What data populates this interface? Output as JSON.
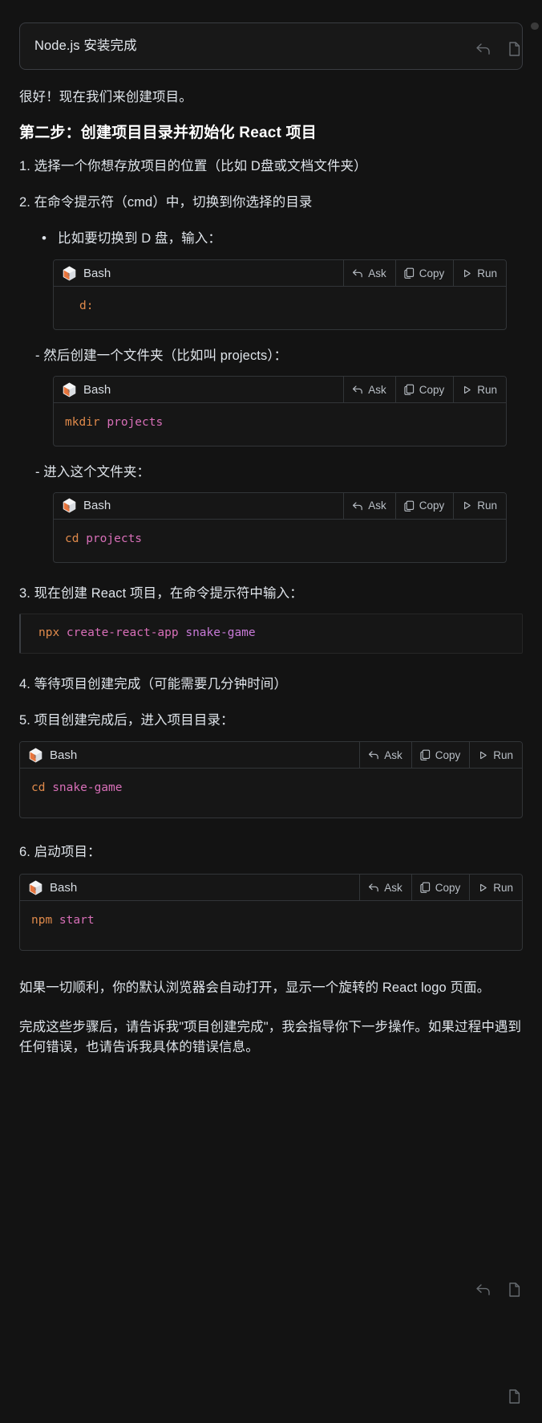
{
  "user_message": {
    "text": "Node.js 安装完成"
  },
  "assistant": {
    "intro": "很好！现在我们来创建项目。",
    "step_title": "第二步：创建项目目录并初始化 React 项目",
    "item1": "1. 选择一个你想存放项目的位置（比如 D盘或文档文件夹）",
    "item2": "2. 在命令提示符（cmd）中，切换到你选择的目录",
    "bullet1": "比如要切换到 D 盘，输入：",
    "dash1": "- 然后创建一个文件夹（比如叫 projects）：",
    "dash2": "- 进入这个文件夹：",
    "item3": "3. 现在创建 React 项目，在命令提示符中输入：",
    "item4": "4. 等待项目创建完成（可能需要几分钟时间）",
    "item5": "5. 项目创建完成后，进入项目目录：",
    "item6": "6. 启动项目：",
    "outro1": "如果一切顺利，你的默认浏览器会自动打开，显示一个旋转的 React logo 页面。",
    "outro2": "完成这些步骤后，请告诉我\"项目创建完成\"，我会指导你下一步操作。如果过程中遇到任何错误，也请告诉我具体的错误信息。"
  },
  "code_blocks": [
    {
      "id": "cd-d-drive",
      "language": "Bash",
      "code": "d:",
      "tokens": [
        {
          "text": "d:",
          "type": "cmd"
        }
      ],
      "actions": {
        "ask": "Ask",
        "copy": "Copy",
        "run": "Run"
      }
    },
    {
      "id": "mkdir-projects",
      "language": "Bash",
      "code": "mkdir projects",
      "tokens": [
        {
          "text": "mkdir",
          "type": "cmd"
        },
        {
          "text": " projects",
          "type": "arg"
        }
      ],
      "actions": {
        "ask": "Ask",
        "copy": "Copy",
        "run": "Run"
      }
    },
    {
      "id": "cd-projects",
      "language": "Bash",
      "code": "cd projects",
      "tokens": [
        {
          "text": "cd",
          "type": "cmd"
        },
        {
          "text": " projects",
          "type": "arg"
        }
      ],
      "actions": {
        "ask": "Ask",
        "copy": "Copy",
        "run": "Run"
      }
    },
    {
      "id": "npx-create-react-app",
      "language": "",
      "code": "npx create-react-app snake-game",
      "tokens": [
        {
          "text": "npx",
          "type": "cmd"
        },
        {
          "text": " create-react-app",
          "type": "arg"
        },
        {
          "text": " snake-game",
          "type": "arg2"
        }
      ],
      "actions": null
    },
    {
      "id": "cd-snake-game",
      "language": "Bash",
      "code": "cd snake-game",
      "tokens": [
        {
          "text": "cd",
          "type": "cmd"
        },
        {
          "text": " snake-game",
          "type": "arg"
        }
      ],
      "actions": {
        "ask": "Ask",
        "copy": "Copy",
        "run": "Run"
      }
    },
    {
      "id": "npm-start",
      "language": "Bash",
      "code": "npm start",
      "tokens": [
        {
          "text": "npm",
          "type": "cmd"
        },
        {
          "text": " start",
          "type": "arg"
        }
      ],
      "actions": {
        "ask": "Ask",
        "copy": "Copy",
        "run": "Run"
      }
    }
  ],
  "icons": {
    "bash": "bash-hexagon-icon",
    "ask": "reply-arrow-icon",
    "copy": "copy-icon",
    "run": "play-triangle-icon",
    "reply": "reply-arrow-icon"
  },
  "colors": {
    "background": "#131313",
    "code_background": "#161616",
    "border": "#323538",
    "text": "#dfe4ea",
    "cmd_token": "#e08a4b",
    "arg_token": "#d86fb8",
    "arg2_token": "#c87ad8"
  }
}
